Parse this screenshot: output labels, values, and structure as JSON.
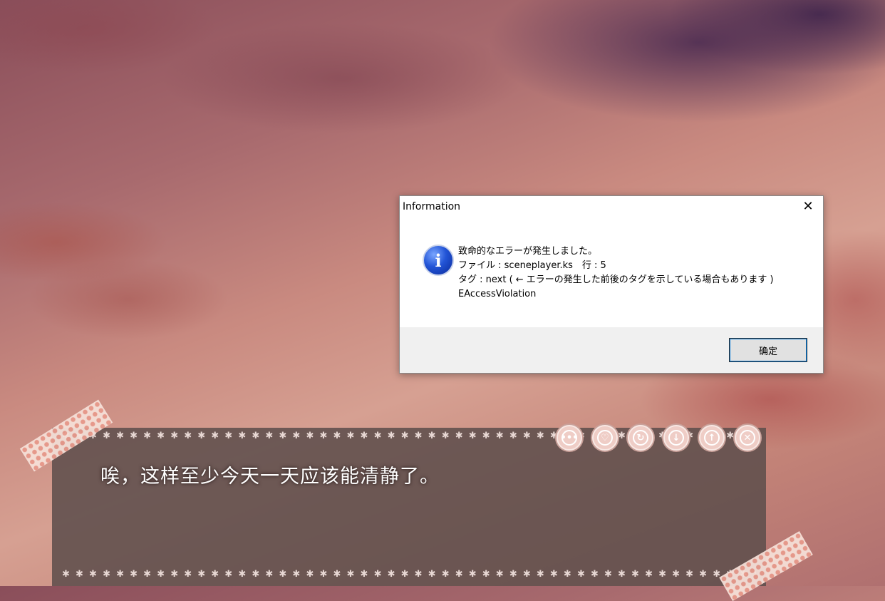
{
  "dialog": {
    "title": "Information",
    "close_glyph": "✕",
    "icon": "info-icon",
    "lines": [
      "致命的なエラーが発生しました。",
      "ファイル : sceneplayer.ks　行 : 5",
      "タグ : next ( ← エラーの発生した前後のタグを示している場合もあります )",
      "EAccessViolation"
    ],
    "ok_label": "确定"
  },
  "game": {
    "message": "唉，这样至少今天一天应该能清静了。",
    "controls": [
      {
        "name": "menu-button",
        "icon": "ellipsis-icon",
        "glyph": "•••"
      },
      {
        "name": "heart-button",
        "icon": "heart-icon",
        "glyph": "♡"
      },
      {
        "name": "replay-button",
        "icon": "replay-icon",
        "glyph": "↻"
      },
      {
        "name": "scroll-down-button",
        "icon": "arrow-down-icon",
        "glyph": "↓"
      },
      {
        "name": "scroll-up-button",
        "icon": "arrow-up-icon",
        "glyph": "↑"
      },
      {
        "name": "close-message-button",
        "icon": "close-icon",
        "glyph": "✕"
      }
    ]
  },
  "colors": {
    "message_box": "#5f4e4c",
    "button_fill": "#efcdc6",
    "dialog_footer": "#f0f0f0"
  }
}
